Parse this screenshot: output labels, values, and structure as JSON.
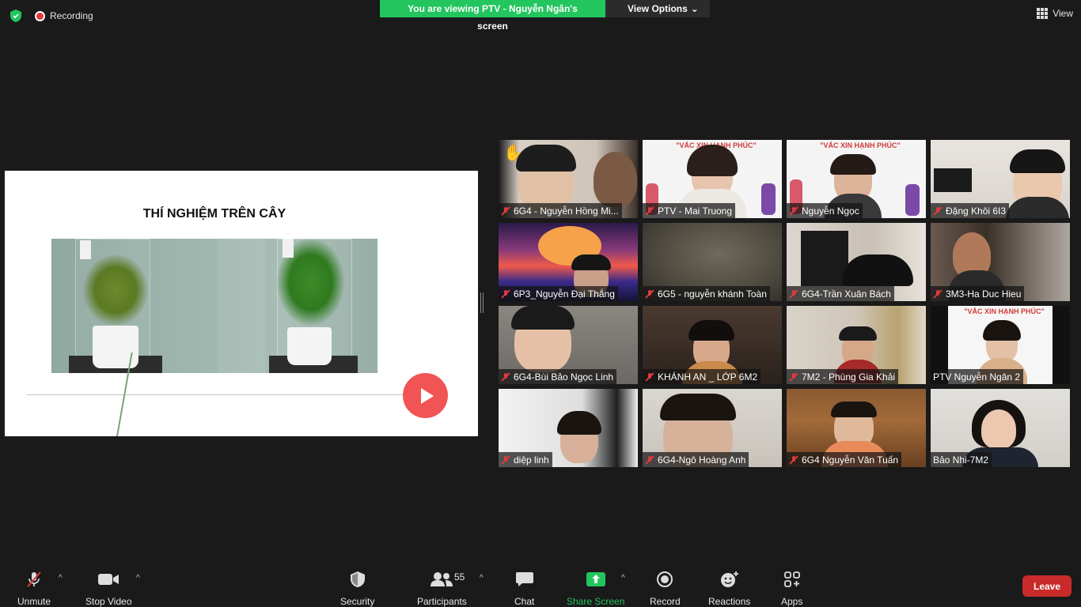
{
  "top": {
    "recording_label": "Recording",
    "viewing_banner": "You are viewing PTV - Nguyễn Ngân's screen",
    "view_options_label": "View Options",
    "view_label": "View"
  },
  "slide": {
    "title": "THÍ NGHIỆM TRÊN CÂY"
  },
  "participants": [
    {
      "name": "6G4 - Nguyễn Hồng Mi..."
    },
    {
      "name": "PTV - Mai Truong"
    },
    {
      "name": "Nguyễn Ngọc"
    },
    {
      "name": "Đặng Khôi 6I3"
    },
    {
      "name": "6P3_Nguyễn Đại Thắng"
    },
    {
      "name": "6G5 - nguyễn khánh Toàn"
    },
    {
      "name": "6G4-Trần Xuân Bách"
    },
    {
      "name": "3M3-Ha Duc Hieu"
    },
    {
      "name": "6G4-Bùi Bảo Ngọc Linh"
    },
    {
      "name": "KHÁNH AN _ LỚP 6M2"
    },
    {
      "name": "7M2 - Phùng Gia Khải"
    },
    {
      "name": "PTV Nguyễn Ngân 2"
    },
    {
      "name": "diệp linh"
    },
    {
      "name": "6G4-Ngô Hoàng Anh"
    },
    {
      "name": "6G4 Nguyễn Văn Tuấn"
    },
    {
      "name": "Bảo Nhi-7M2"
    }
  ],
  "banner_text": "\"VẮC XIN HẠNH PHÚC\"",
  "toolbar": {
    "unmute": "Unmute",
    "stop_video": "Stop Video",
    "security": "Security",
    "participants": "Participants",
    "participants_count": "55",
    "chat": "Chat",
    "share_screen": "Share Screen",
    "record": "Record",
    "reactions": "Reactions",
    "apps": "Apps",
    "leave": "Leave"
  }
}
